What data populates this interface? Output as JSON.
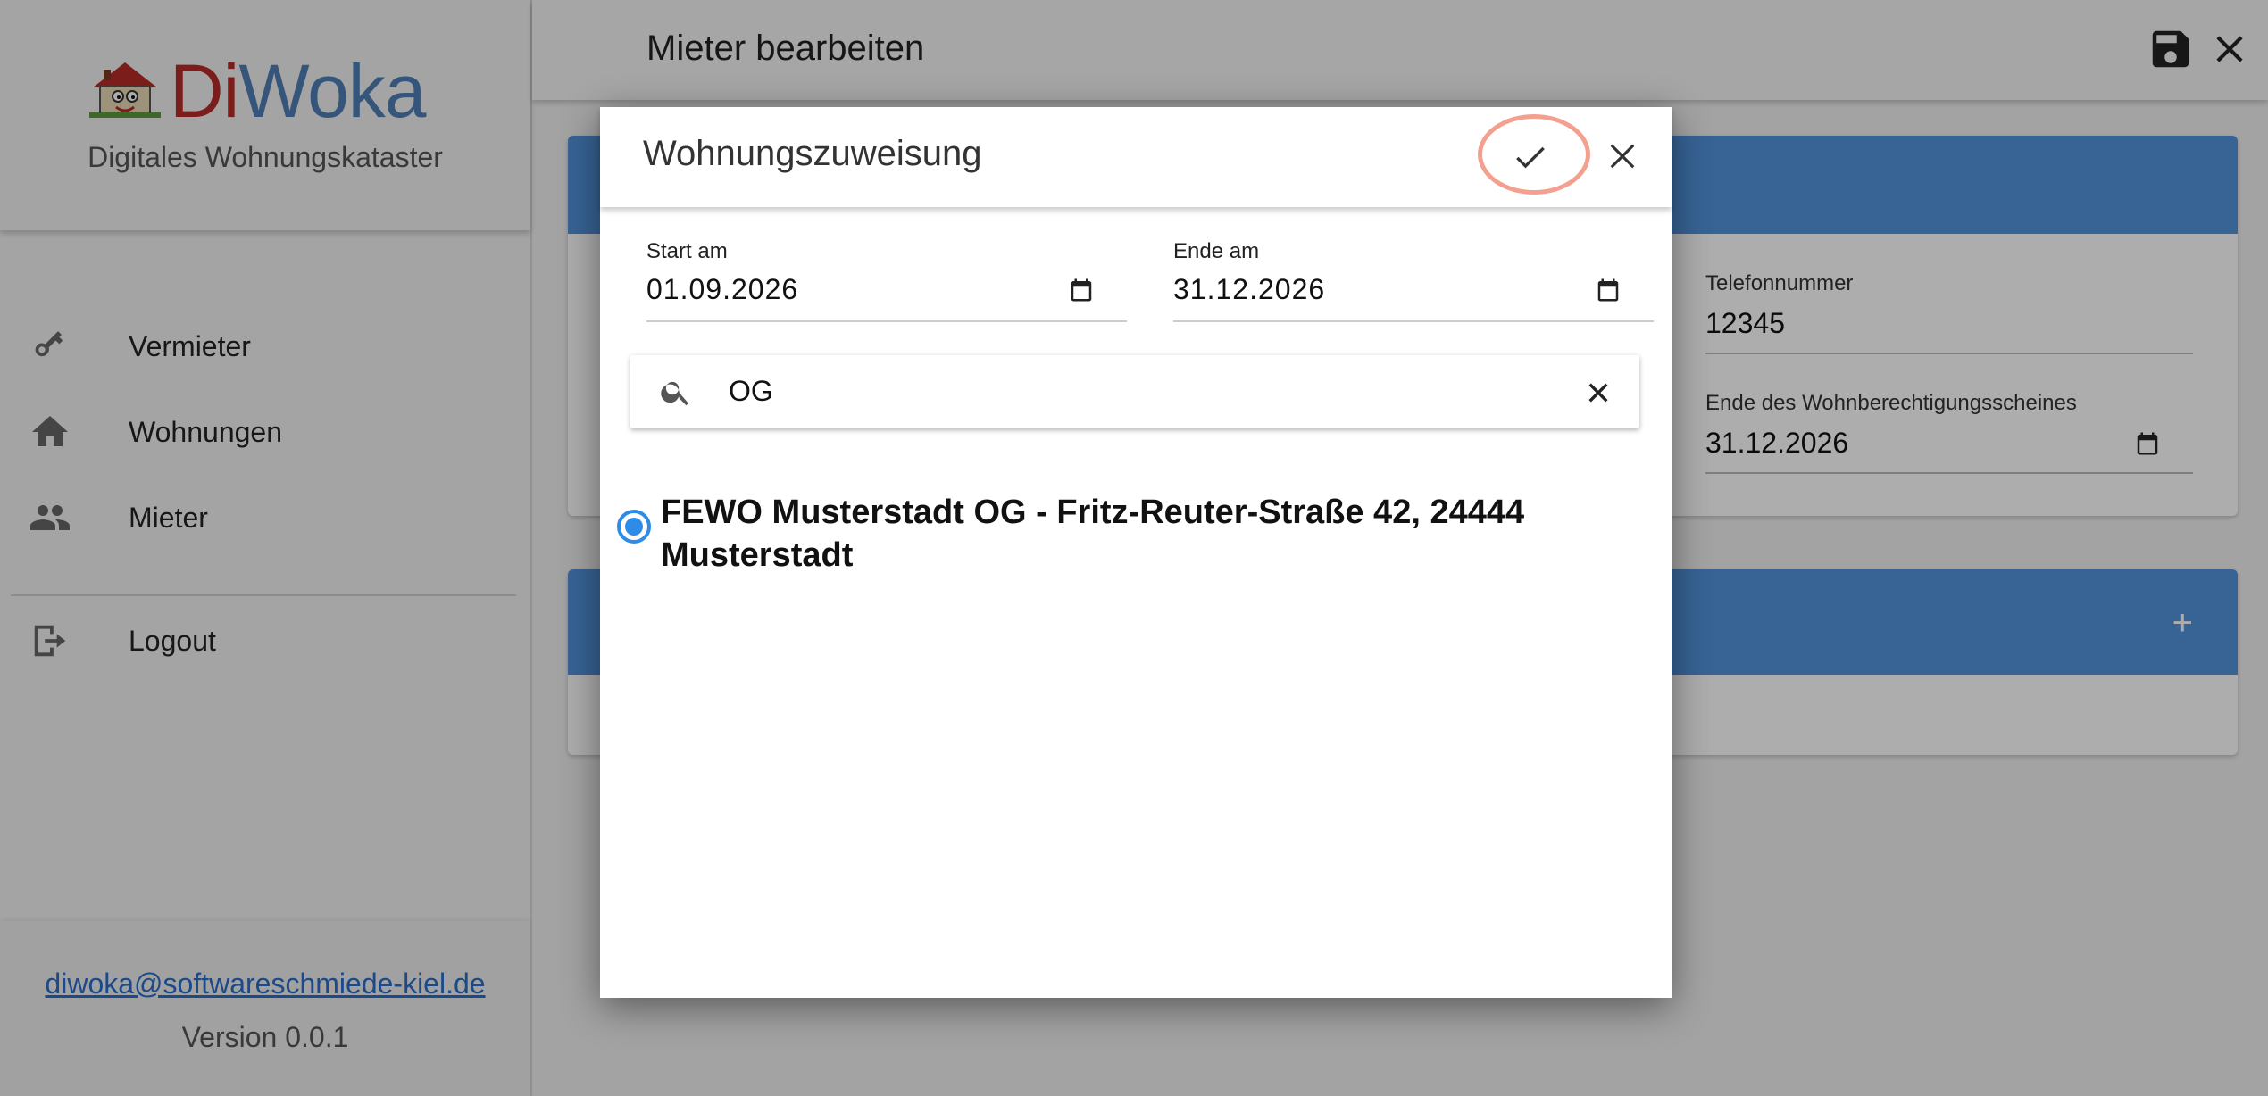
{
  "app": {
    "logo_di": "Di",
    "logo_woka": "Woka",
    "subtitle": "Digitales Wohnungskataster"
  },
  "sidebar": {
    "items": [
      {
        "label": "Vermieter",
        "icon": "key-icon"
      },
      {
        "label": "Wohnungen",
        "icon": "home-icon"
      },
      {
        "label": "Mieter",
        "icon": "people-icon"
      }
    ],
    "logout": {
      "label": "Logout",
      "icon": "logout-icon"
    },
    "footer_email": "diwoka@softwareschmiede-kiel.de",
    "version": "Version 0.0.1"
  },
  "header": {
    "title": "Mieter bearbeiten",
    "save_icon": "save-icon",
    "close_icon": "close-icon"
  },
  "background_card": {
    "phone_label": "Telefonnummer",
    "phone_value": "12345",
    "wbs_end_label": "Ende des Wohnberechtigungsscheines",
    "wbs_end_value": "31.12.2026"
  },
  "dialog": {
    "title": "Wohnungszuweisung",
    "start_label": "Start am",
    "start_value": "01.09.2026",
    "end_label": "Ende am",
    "end_value": "31.12.2026",
    "search_value": "OG",
    "option_line1": "FEWO Musterstadt OG - Fritz-Reuter-Straße 42, 24444",
    "option_line2": "Musterstadt",
    "option_selected": true
  },
  "colors": {
    "accent": "#5193dc",
    "logo_red": "#b52b27",
    "logo_blue": "#4f7fb4",
    "highlight_ring": "#f4a090",
    "radio": "#2d8ce8"
  }
}
